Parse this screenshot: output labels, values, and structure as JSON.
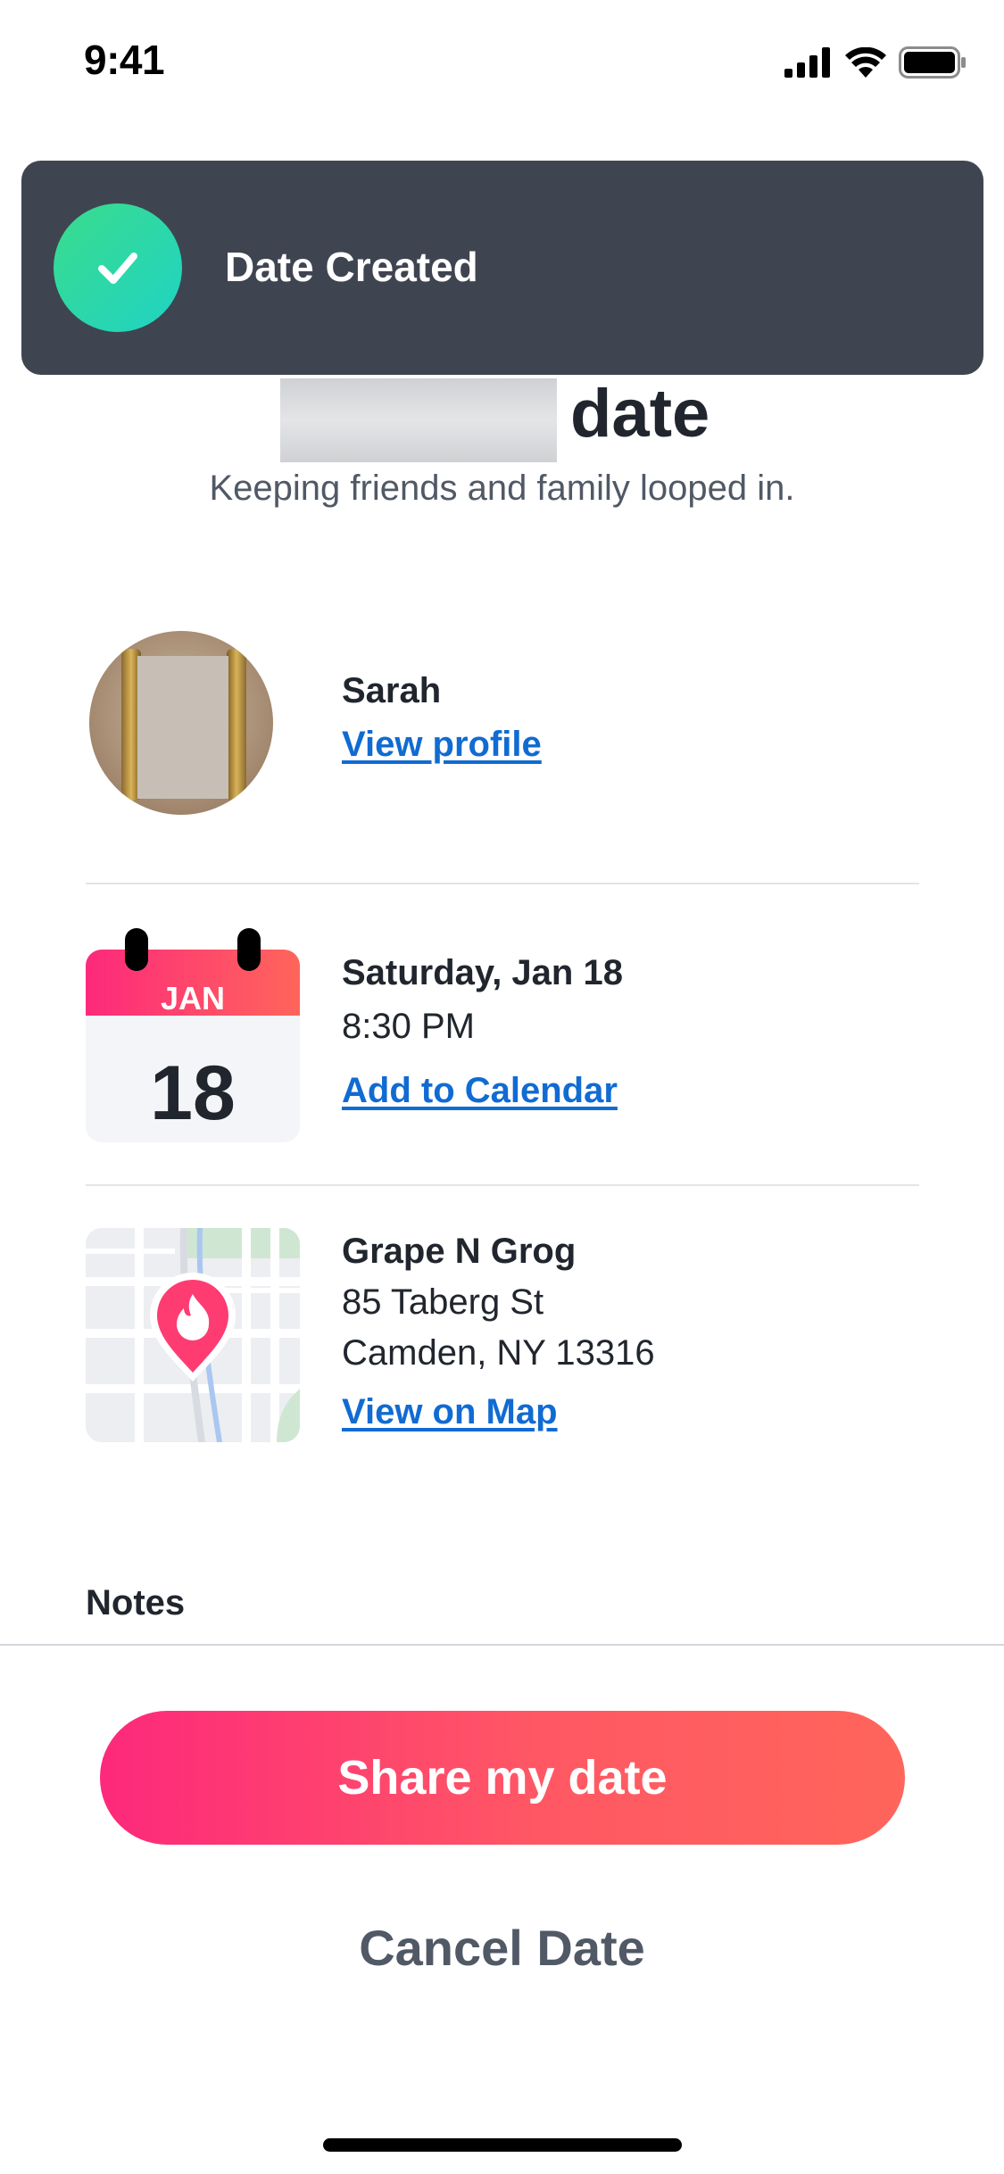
{
  "status_bar": {
    "time": "9:41",
    "icons": [
      "cellular-signal-icon",
      "wifi-icon",
      "battery-icon"
    ]
  },
  "toast": {
    "title": "Date Created",
    "icon": "checkmark-icon"
  },
  "header": {
    "title_suffix": "date",
    "subtitle": "Keeping friends and family looped in."
  },
  "match": {
    "name": "Sarah",
    "view_profile_label": "View profile"
  },
  "date_info": {
    "calendar_month": "JAN",
    "calendar_day": "18",
    "title": "Saturday, Jan 18",
    "time": "8:30 PM",
    "add_to_calendar_label": "Add to Calendar"
  },
  "venue": {
    "name": "Grape N Grog",
    "address_line1": "85 Taberg St",
    "address_line2": "Camden, NY 13316",
    "view_on_map_label": "View on Map"
  },
  "notes": {
    "label": "Notes"
  },
  "actions": {
    "share_label": "Share my date",
    "cancel_label": "Cancel Date"
  },
  "colors": {
    "brand_gradient_start": "#fd297b",
    "brand_gradient_end": "#ff655b",
    "link": "#106bd2",
    "toast_bg": "#3f4550",
    "success_green": "#2ed8a8"
  }
}
